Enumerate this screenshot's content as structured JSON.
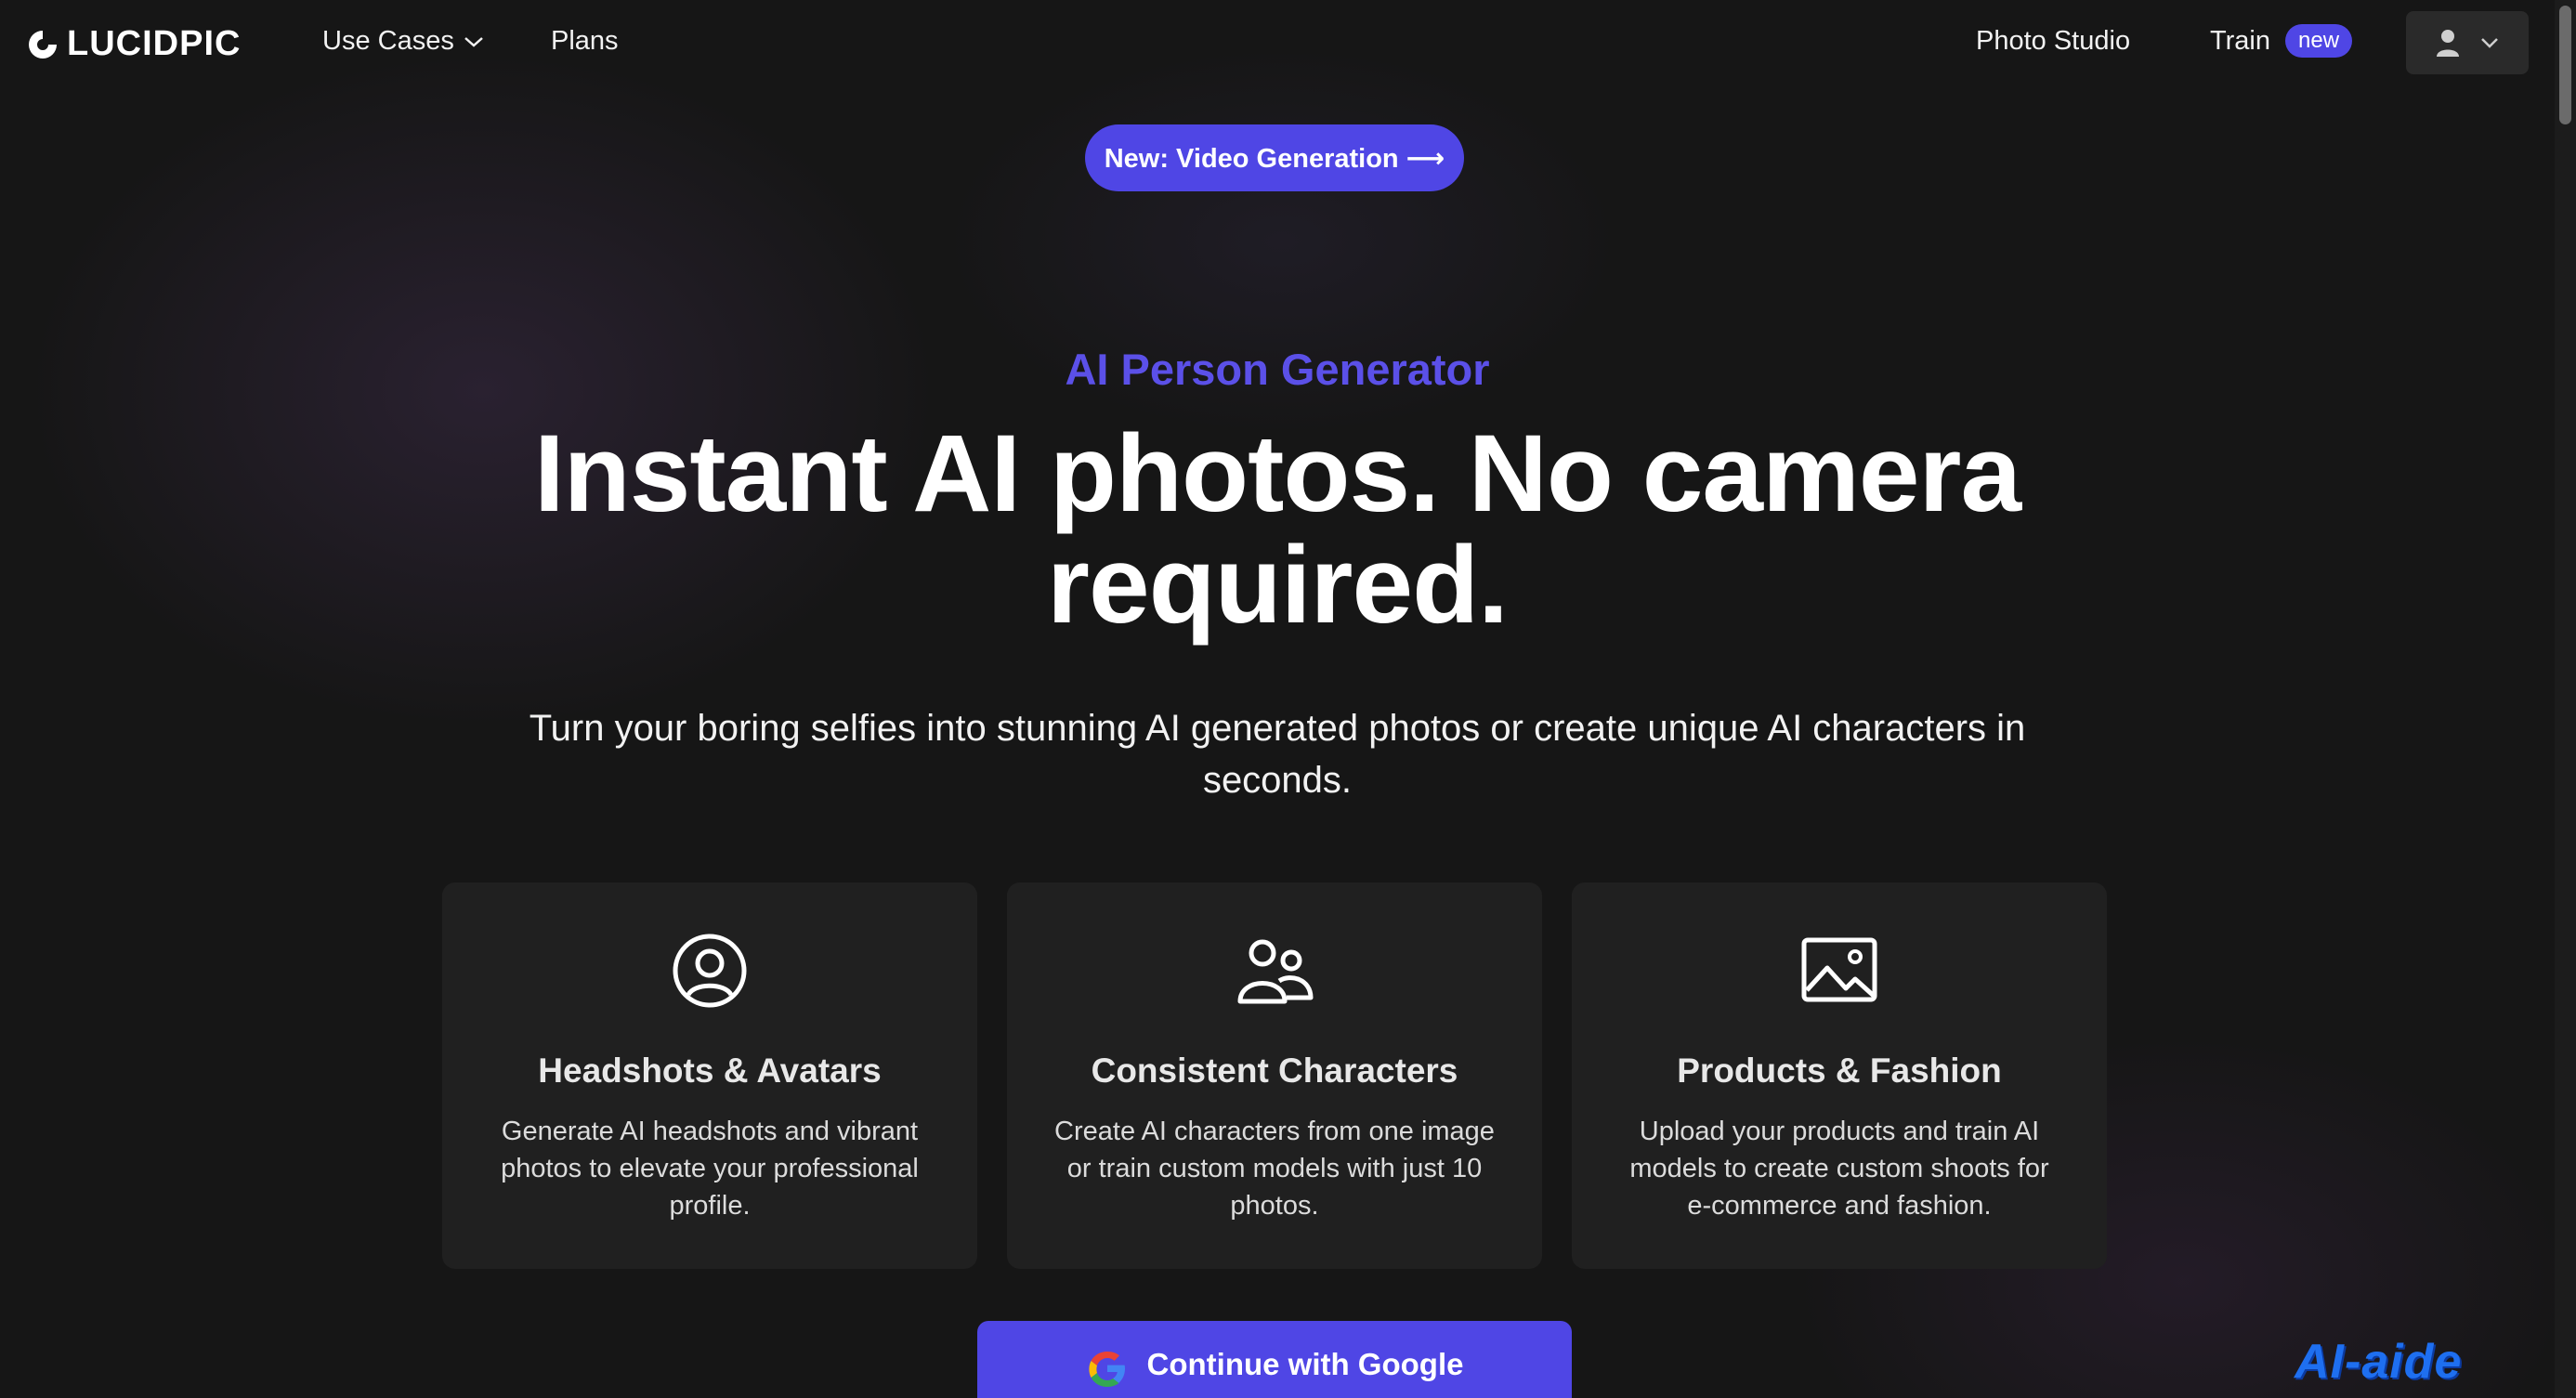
{
  "nav": {
    "logo_text": "LUCIDPIC",
    "use_cases_label": "Use Cases",
    "plans_label": "Plans",
    "photo_studio_label": "Photo Studio",
    "train_label": "Train",
    "train_badge": "new",
    "icons": {
      "logo": "lucidpic-logo-icon",
      "user": "user-icon",
      "chevron": "chevron-down-icon"
    }
  },
  "announcement": {
    "label": "New: Video Generation ⟶"
  },
  "hero": {
    "eyebrow": "AI Person Generator",
    "headline": "Instant AI photos. No camera required.",
    "subhead": "Turn your boring selfies into stunning AI generated photos or create unique AI characters in seconds."
  },
  "cards": [
    {
      "icon": "user-circle-icon",
      "title": "Headshots & Avatars",
      "desc": "Generate AI headshots and vibrant photos to elevate your professional profile."
    },
    {
      "icon": "users-icon",
      "title": "Consistent Characters",
      "desc": "Create AI characters from one image or train custom models with just 10 photos."
    },
    {
      "icon": "image-icon",
      "title": "Products & Fashion",
      "desc": "Upload your products and train AI models to create custom shoots for e-commerce and fashion."
    }
  ],
  "cta": {
    "label": "Continue with Google",
    "icon": "google-icon"
  },
  "watermark": "AI-aide",
  "colors": {
    "accent": "#4f46e5",
    "eyebrow": "#5b50e8",
    "background": "#161616",
    "card": "#202020"
  }
}
